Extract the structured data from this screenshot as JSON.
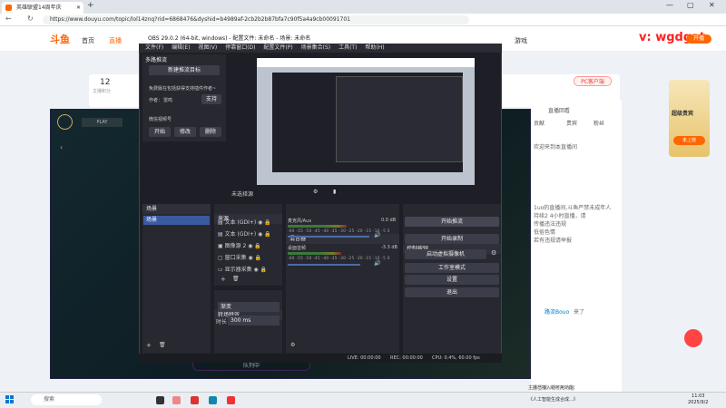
{
  "browser": {
    "tab_title": "英雄联盟14周年庆",
    "tab_close": "✕",
    "new_tab": "+",
    "url": "https://www.douyu.com/topic/lol14znq?rid=6868476&dyshid=b4989af-2cb2b2b87bfa7c90f5a4a9cb00091701",
    "minimize": "—",
    "maximize": "▢",
    "close": "✕",
    "back": "←",
    "refresh": "↻"
  },
  "site": {
    "logo": "斗鱼",
    "nav": [
      "首页",
      "直播",
      "游戏"
    ],
    "watermark": "v: wgdgat",
    "download": "开播",
    "pc_live": "PC客户端",
    "stat_num": "12",
    "stat_label": "主播积分",
    "chat_tabs": [
      "直播回看",
      "贡献",
      "贵宾",
      "粉丝"
    ],
    "chat_lines": [
      "欢迎来到本直播间",
      "1uo的直播间,斗鱼严禁未成年人",
      "持续2 4小时直播，请",
      "注意",
      "所有直播间的内容",
      "传播违法违规",
      "低俗色情",
      "吸烟酗酒",
      "等",
      "若有违规请举报",
      "谨防",
      "上当受骗"
    ],
    "chat_user": "路流Bouo",
    "chat_user_action": "来了",
    "chat_placeholder": "这里输入聊天内容",
    "rank_badge": "超级贵宾",
    "rank_cta": "未上榜",
    "rank_title": "超级贵宾",
    "video_btn": "队列中",
    "sub_btn": "积分兑换"
  },
  "obs": {
    "title": "OBS 29.0.2 (64-bit, windows) - 配置文件: 未命名 - 场景: 未命名",
    "menu": [
      "文件(F)",
      "编辑(E)",
      "视图(V)",
      "停靠窗口(D)",
      "配置文件(P)",
      "场景集合(S)",
      "工具(T)",
      "帮助(H)"
    ],
    "multistream": {
      "title": "多路推流",
      "new_target": "新建推流目标",
      "free_text": "免费版在包括获得支持插件作者~",
      "author_label": "作者：",
      "author_name": "雷鸣",
      "support": "支持",
      "mic_label": "微信视频号",
      "start": "开始",
      "edit": "修改",
      "delete": "删除"
    },
    "preview_no_source": "未选择源",
    "scenes": {
      "title": "场景",
      "items": [
        "场景"
      ]
    },
    "sources": {
      "title": "来源",
      "items": [
        "文本 (GDI+)",
        "文本 (GDI+)",
        "图像源 2",
        "窗口采集",
        "显示器采集"
      ]
    },
    "mixer": {
      "title": "混音器",
      "tracks": [
        {
          "name": "麦克风/Aux",
          "db": "0.0 dB",
          "level": 0.55
        },
        {
          "name": "桌面音频",
          "db": "-3.3 dB",
          "level": 0.5
        }
      ],
      "scale": "-60 -55 -50 -45 -40 -35 -30 -25 -20 -15 -10 -5 0"
    },
    "transitions": {
      "title": "转场特效",
      "type": "渐变",
      "duration_label": "时长",
      "duration": "300 ms"
    },
    "controls": {
      "title": "控制按钮",
      "items": [
        "开始推流",
        "开始录制",
        "启动虚拟摄像机",
        "工作室模式",
        "设置",
        "退出"
      ]
    },
    "status": {
      "live": "LIVE: 00:00:00",
      "rec": "REC: 00:00:00",
      "cpu": "CPU: 0.4%, 60.00 fps"
    }
  },
  "taskbar": {
    "search": "搜索",
    "time": "11:03",
    "date": "2025/9/2",
    "notice": "主播已接入新可用功能",
    "ai_task": "《人工智能生成合成...》"
  }
}
